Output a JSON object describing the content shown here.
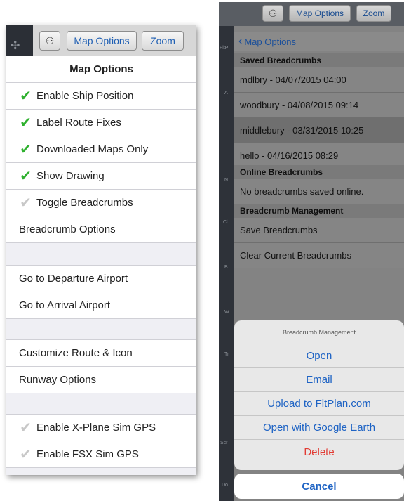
{
  "left": {
    "toolbar": {
      "map_options": "Map Options",
      "zoom": "Zoom"
    },
    "header": "Map Options",
    "toggles": [
      {
        "label": "Enable Ship Position",
        "checked": true
      },
      {
        "label": "Label Route Fixes",
        "checked": true
      },
      {
        "label": "Downloaded Maps Only",
        "checked": true
      },
      {
        "label": "Show Drawing",
        "checked": true
      },
      {
        "label": "Toggle Breadcrumbs",
        "checked": false
      }
    ],
    "breadcrumb_options": "Breadcrumb Options",
    "go_departure": "Go to Departure Airport",
    "go_arrival": "Go to Arrival Airport",
    "customize_route": "Customize Route & Icon",
    "runway_options": "Runway Options",
    "sim_toggles": [
      {
        "label": "Enable X-Plane Sim GPS",
        "checked": false
      },
      {
        "label": "Enable FSX Sim GPS",
        "checked": false
      }
    ]
  },
  "right": {
    "toolbar": {
      "map_options": "Map Options",
      "zoom": "Zoom"
    },
    "back_label": "Map Options",
    "sections": {
      "saved": "Saved Breadcrumbs",
      "online": "Online Breadcrumbs",
      "management": "Breadcrumb Management"
    },
    "saved_items": [
      "mdlbry - 04/07/2015 04:00",
      "woodbury - 04/08/2015 09:14",
      "middlebury - 03/31/2015 10:25",
      "hello - 04/16/2015 08:29"
    ],
    "online_empty": "No breadcrumbs saved online.",
    "save_breadcrumbs": "Save Breadcrumbs",
    "clear_breadcrumbs": "Clear Current Breadcrumbs",
    "sheet": {
      "title": "Breadcrumb Management",
      "open": "Open",
      "email": "Email",
      "upload": "Upload to FltPlan.com",
      "google_earth": "Open with Google Earth",
      "delete": "Delete",
      "cancel": "Cancel"
    },
    "side_labels": [
      "FltP",
      "A",
      "N",
      "Cl",
      "B",
      "W",
      "Tr",
      "Scr",
      "Do"
    ]
  }
}
